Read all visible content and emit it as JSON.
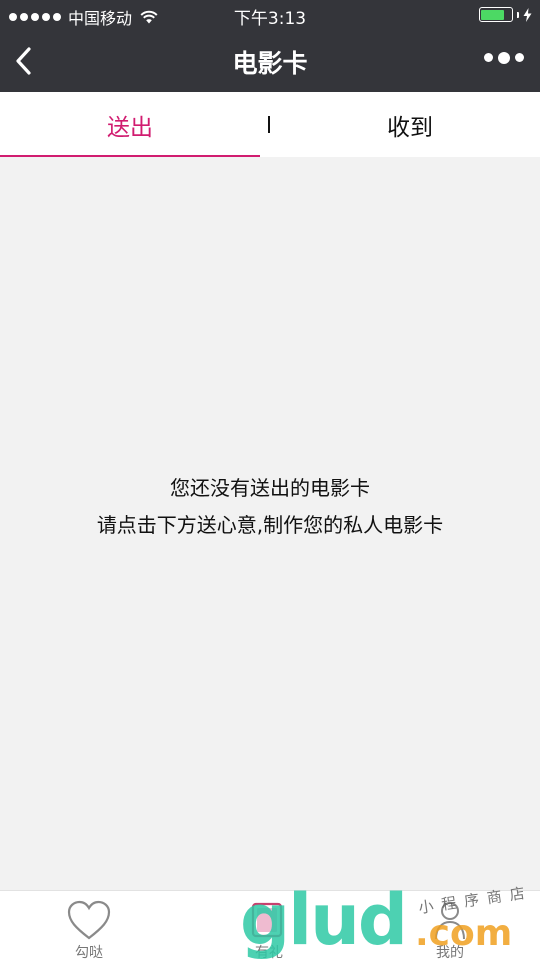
{
  "status_bar": {
    "carrier": "中国移动",
    "time": "下午3:13",
    "battery_percent": 80,
    "signal_bars": 5
  },
  "nav": {
    "title": "电影卡",
    "back_icon": "chevron-left-icon",
    "more_icon": "more-dots-icon"
  },
  "tabs": [
    {
      "label": "送出",
      "active": true
    },
    {
      "label": "收到",
      "active": false
    }
  ],
  "empty_state": {
    "line1": "您还没有送出的电影卡",
    "line2": "请点击下方送心意,制作您的私人电影卡"
  },
  "tabbar": [
    {
      "label": "勾哒",
      "icon": "heart-icon"
    },
    {
      "label": "有礼",
      "icon": "gift-icon"
    },
    {
      "label": "我的",
      "icon": "user-icon"
    }
  ],
  "watermark": {
    "main": "glud",
    "dotcom": ".com",
    "sub": "小程序商店"
  },
  "colors": {
    "header_bg": "#34353a",
    "accent": "#d11c70",
    "background": "#f2f2f2",
    "battery": "#4cd964"
  }
}
